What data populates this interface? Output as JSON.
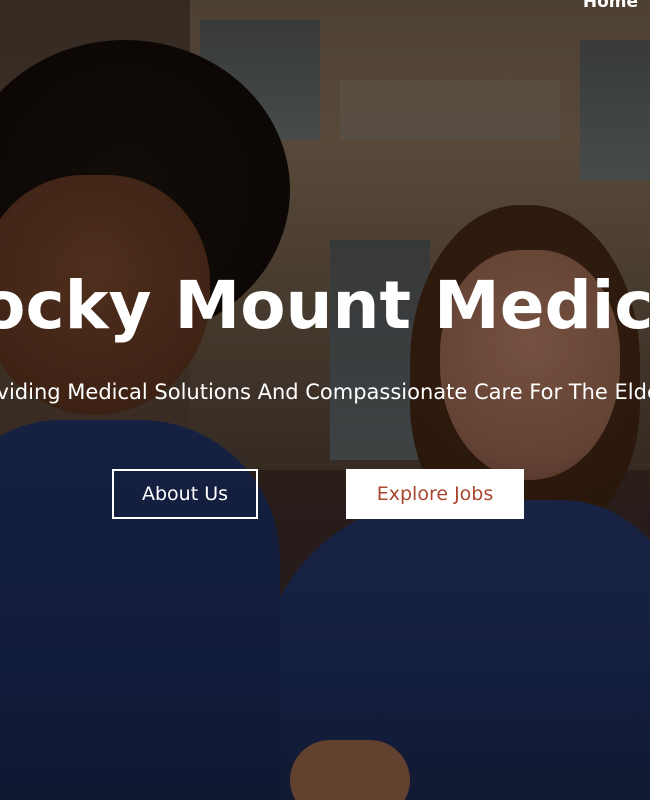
{
  "nav": {
    "home_label": "Home"
  },
  "hero": {
    "headline": "Rocky Mount Medical",
    "subline": "Providing Medical Solutions And Compassionate Care For The Elderly",
    "buttons": {
      "about_label": "About Us",
      "jobs_label": "Explore Jobs"
    }
  },
  "colors": {
    "text": "#ffffff",
    "jobs_button_text": "#a9472f",
    "jobs_button_bg": "#ffffff"
  }
}
